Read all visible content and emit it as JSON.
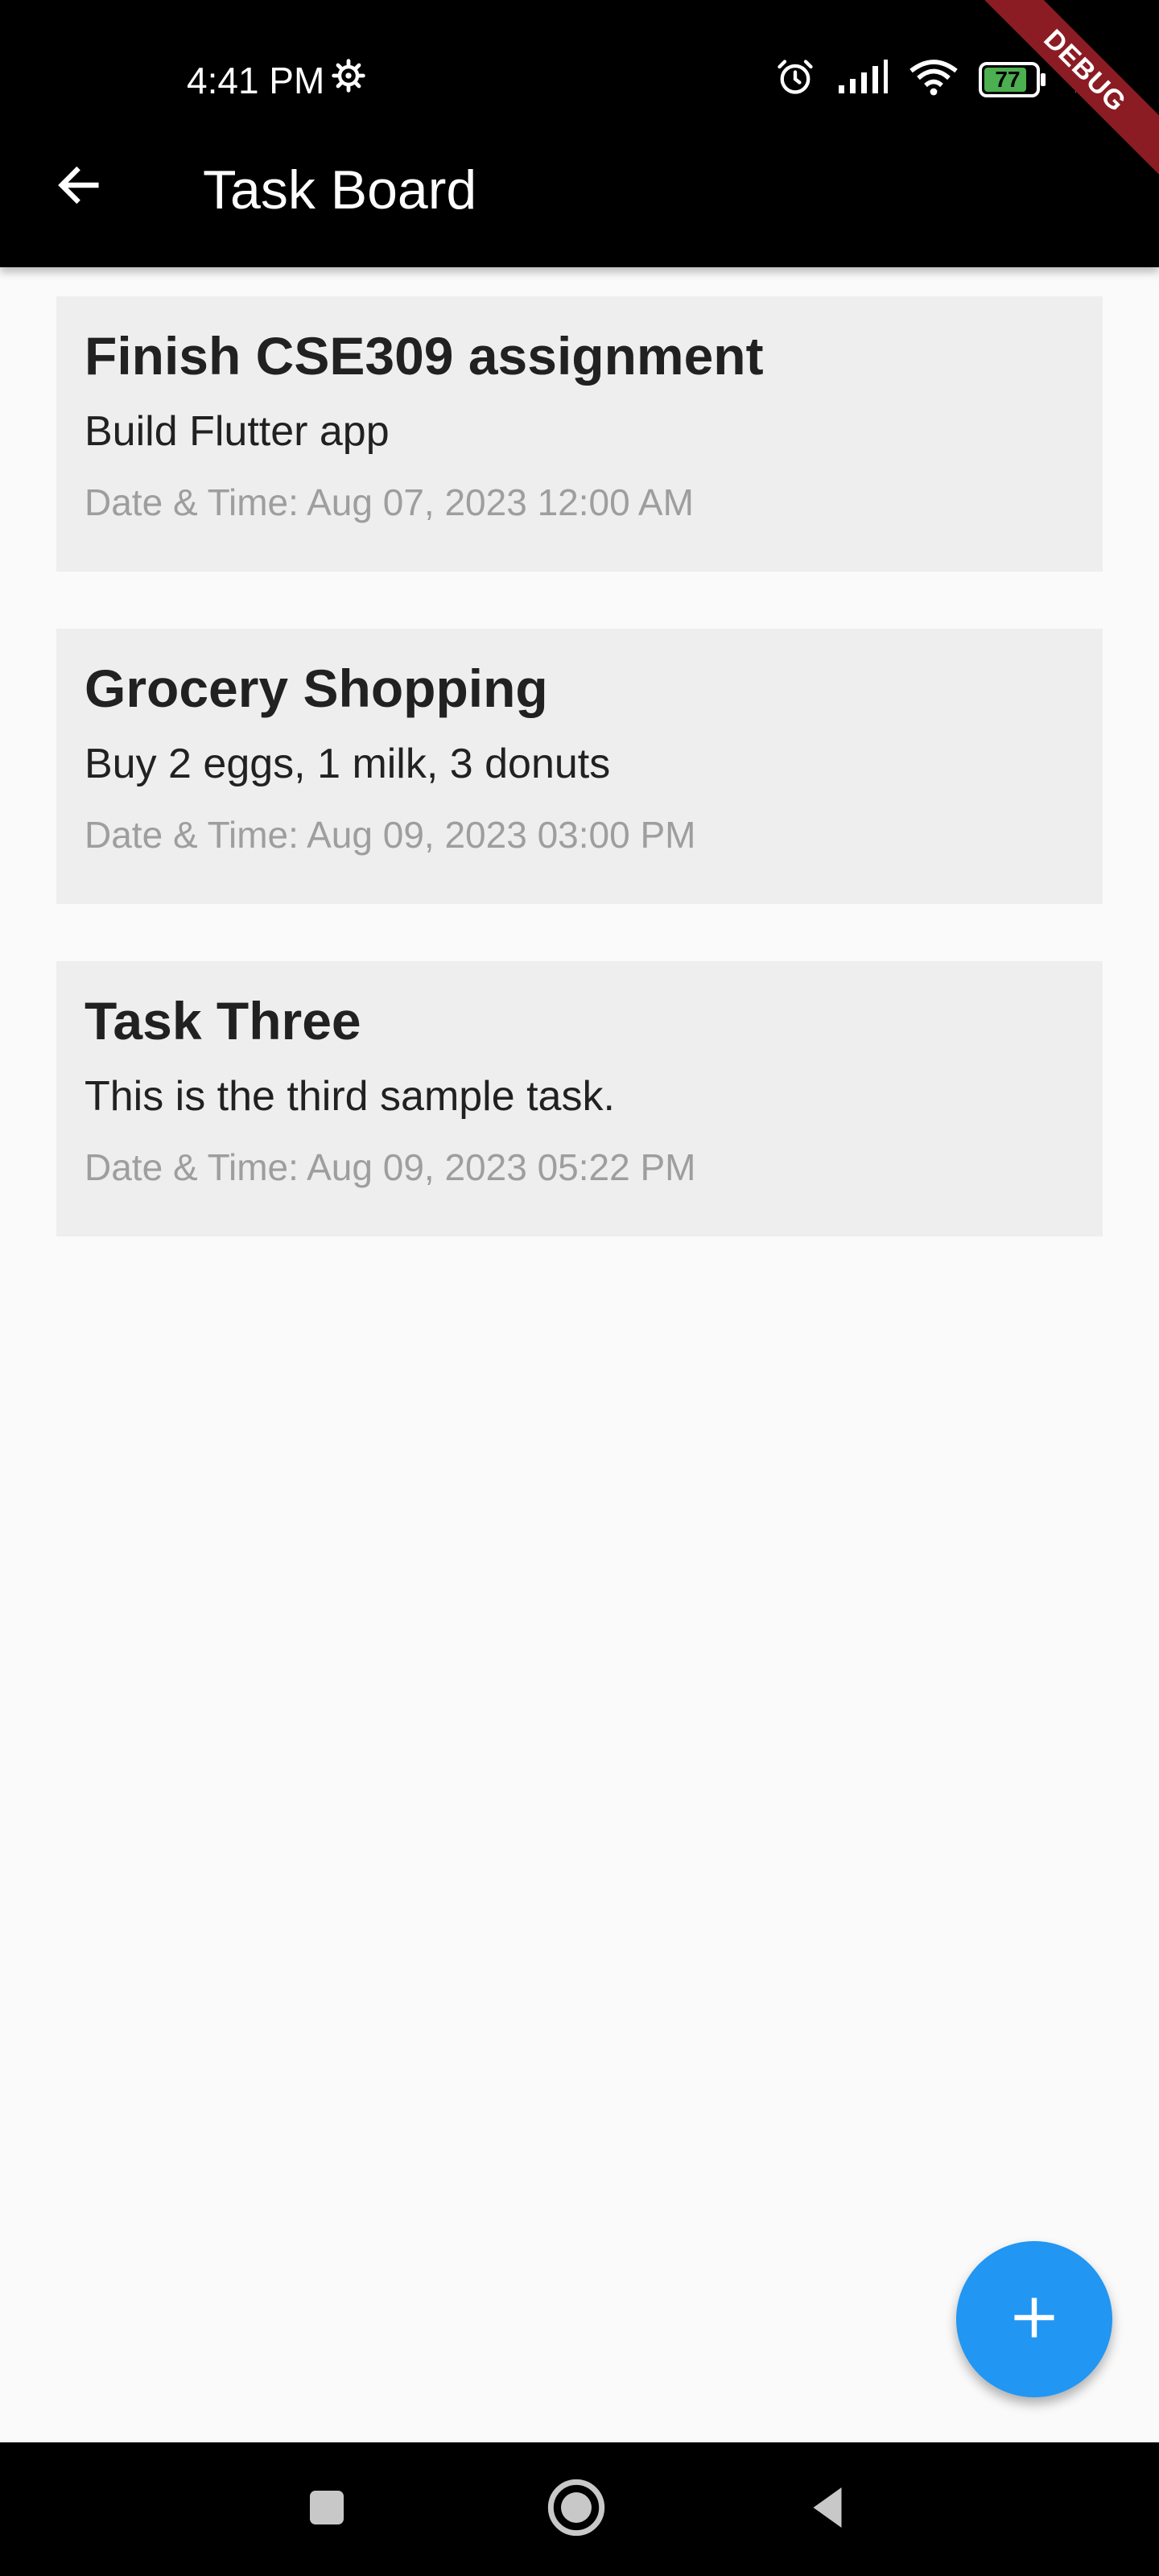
{
  "status_bar": {
    "time": "4:41 PM",
    "battery_level": "77",
    "icons": [
      "settings-icon",
      "alarm-icon",
      "signal-icon",
      "wifi-icon",
      "battery-icon",
      "charging-icon"
    ]
  },
  "app_bar": {
    "title": "Task Board",
    "back_icon": "arrow-back-icon"
  },
  "debug_banner": "DEBUG",
  "tasks": [
    {
      "title": "Finish CSE309 assignment",
      "description": "Build Flutter app",
      "datetime": "Date & Time: Aug 07, 2023 12:00 AM"
    },
    {
      "title": "Grocery Shopping",
      "description": "Buy 2 eggs, 1 milk, 3 donuts",
      "datetime": "Date & Time: Aug 09, 2023 03:00 PM"
    },
    {
      "title": "Task Three",
      "description": "This is the third sample task.",
      "datetime": "Date & Time: Aug 09, 2023 05:22 PM"
    }
  ],
  "fab": {
    "icon": "add-icon"
  },
  "nav_bar": {
    "buttons": [
      "recents-icon",
      "home-icon",
      "back-icon"
    ]
  },
  "colors": {
    "app_bar": "#000000",
    "background": "#fafafa",
    "card": "#eeeeee",
    "fab": "#2196f3",
    "date_text": "#9e9e9e",
    "debug_ribbon": "#8b1c24",
    "battery": "#4caf50"
  }
}
